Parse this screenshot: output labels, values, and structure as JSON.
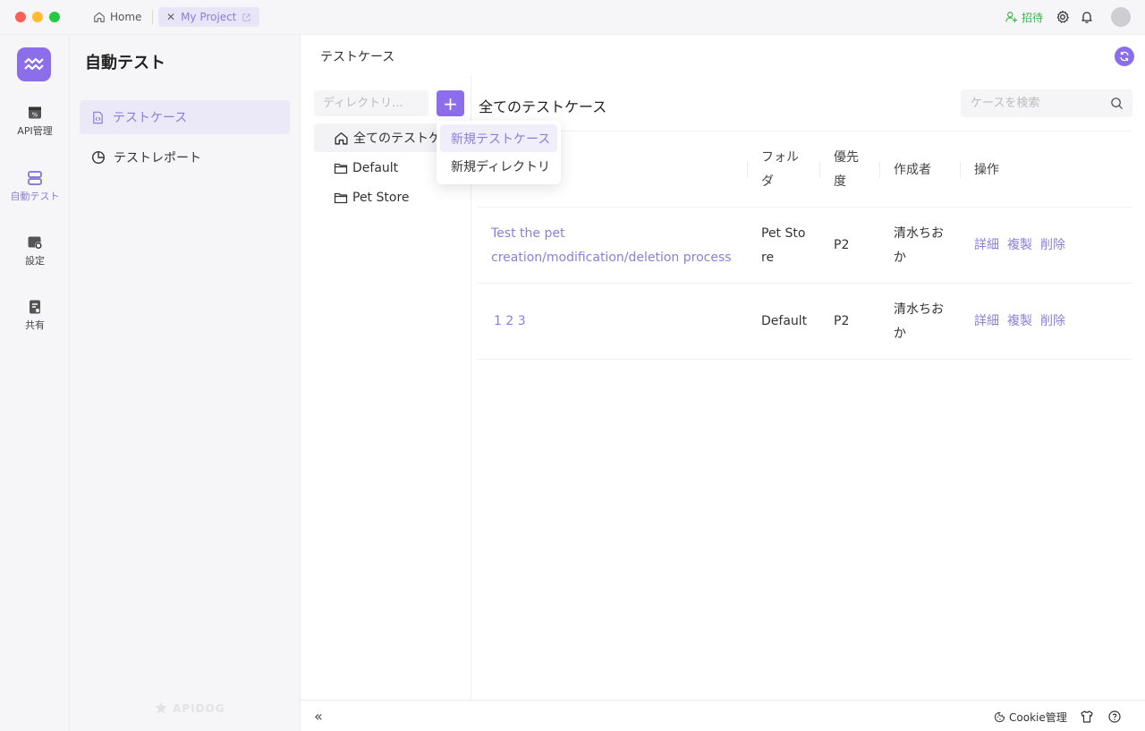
{
  "tabs": {
    "home_label": "Home",
    "project_label": "My Project"
  },
  "header": {
    "invite_label": "招待"
  },
  "nav": {
    "items": [
      {
        "label": "API管理"
      },
      {
        "label": "自動テスト"
      },
      {
        "label": "設定"
      },
      {
        "label": "共有"
      }
    ]
  },
  "sidebar": {
    "title": "自動テスト",
    "items": [
      {
        "label": "テストケース"
      },
      {
        "label": "テストレポート"
      }
    ],
    "watermark": "APIDOG"
  },
  "main": {
    "title": "テストケース",
    "dir_search_placeholder": "ディレクトリ...",
    "add_button": "+",
    "tree": [
      {
        "label": "全てのテストケース"
      },
      {
        "label": "Default"
      },
      {
        "label": "Pet Store"
      }
    ],
    "dropdown": [
      {
        "label": "新規テストケース"
      },
      {
        "label": "新規ディレクトリ"
      }
    ],
    "list_title": "全てのテストケース",
    "case_search_placeholder": "ケースを検索",
    "columns": {
      "folder": "フォルダ",
      "priority": "優先度",
      "creator": "作成者",
      "actions": "操作"
    },
    "rows": [
      {
        "name": "Test the pet creation/modification/deletion process",
        "folder": "Pet Store",
        "priority": "P2",
        "creator": "清水ちおか",
        "detail": "詳細",
        "copy": "複製",
        "delete": "削除"
      },
      {
        "name": "1 2 3",
        "folder": "Default",
        "priority": "P2",
        "creator": "清水ちおか",
        "detail": "詳細",
        "copy": "複製",
        "delete": "削除"
      }
    ]
  },
  "footer": {
    "collapse_label": "«",
    "cookie_label": "Cookie管理"
  },
  "colors": {
    "accent": "#8c6dea",
    "accent_text": "#8a7fd8",
    "invite_green": "#3bb44a",
    "sidebar_bg": "#f6f6f8"
  }
}
